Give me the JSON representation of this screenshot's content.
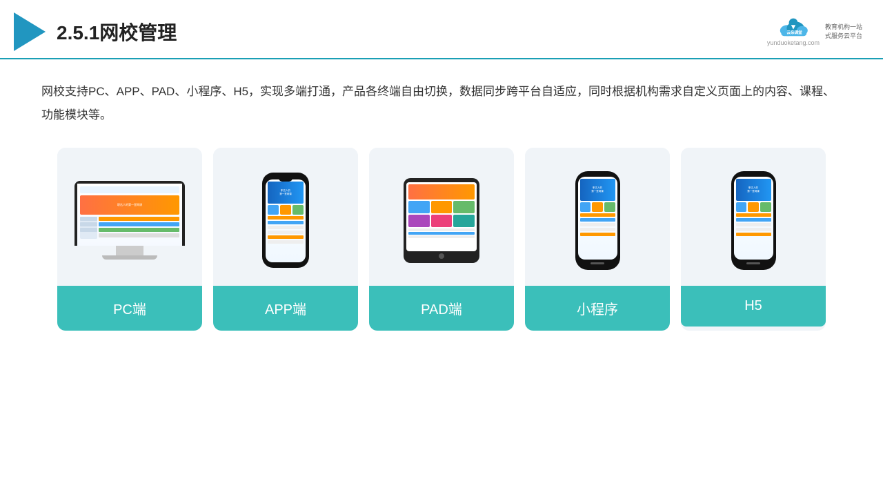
{
  "header": {
    "title": "2.5.1网校管理",
    "brand_name": "云朵课堂",
    "brand_url": "yunduoketang.com",
    "brand_tagline_1": "教育机构一站",
    "brand_tagline_2": "式服务云平台"
  },
  "description": {
    "text": "网校支持PC、APP、PAD、小程序、H5，实现多端打通，产品各终端自由切换，数据同步跨平台自适应，同时根据机构需求自定义页面上的内容、课程、功能模块等。"
  },
  "cards": [
    {
      "id": "pc",
      "label": "PC端"
    },
    {
      "id": "app",
      "label": "APP端"
    },
    {
      "id": "pad",
      "label": "PAD端"
    },
    {
      "id": "miniprogram",
      "label": "小程序"
    },
    {
      "id": "h5",
      "label": "H5"
    }
  ],
  "colors": {
    "accent": "#3bbfba",
    "header_line": "#1a9fb5",
    "logo_blue": "#2196c0"
  }
}
